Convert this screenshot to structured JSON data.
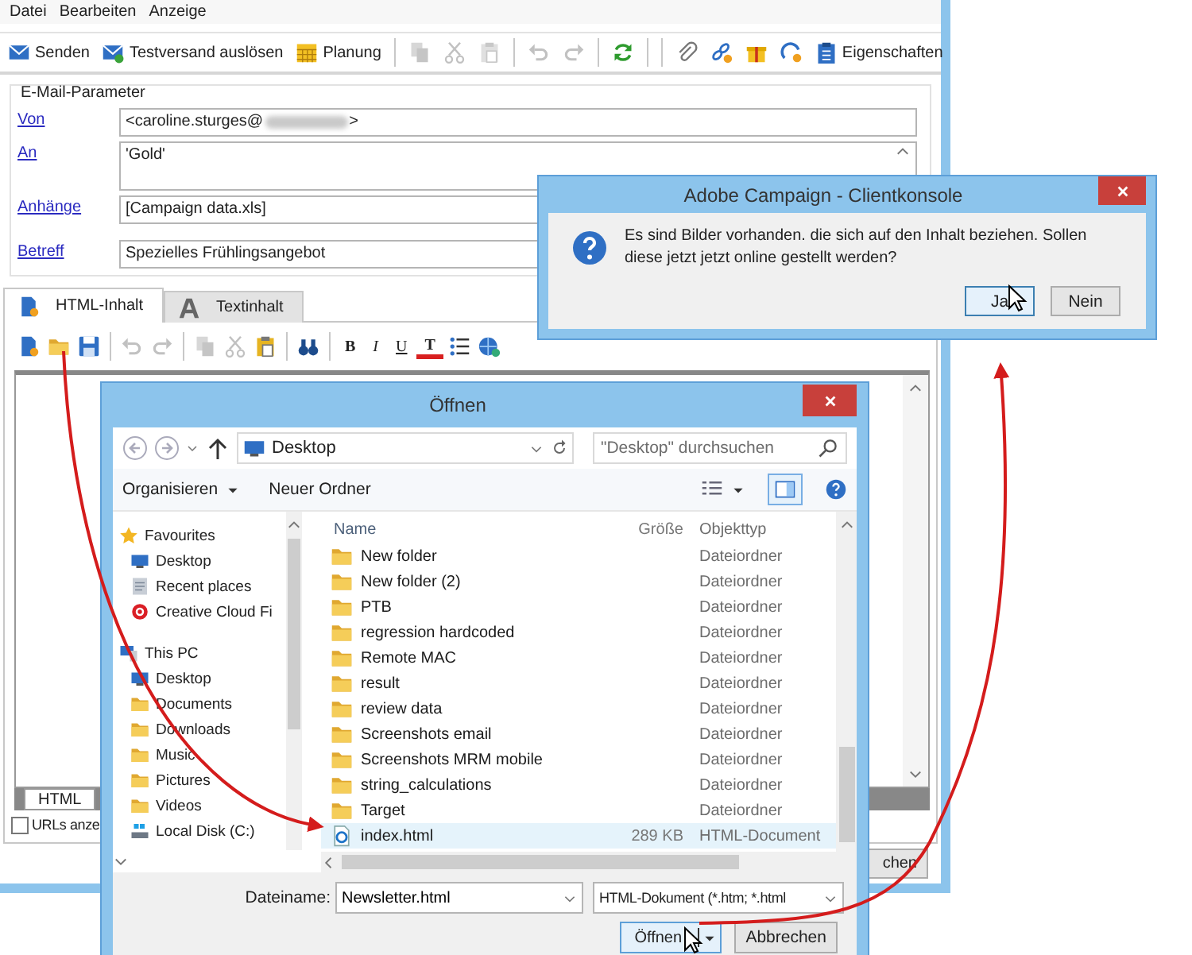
{
  "main_window": {
    "menu": [
      {
        "label": "Datei"
      },
      {
        "label": "Bearbeiten"
      },
      {
        "label": "Anzeige"
      }
    ],
    "toolbar": [
      {
        "kind": "button",
        "label": "Senden",
        "disabled": false
      },
      {
        "kind": "button",
        "label": "Testversand auslösen",
        "disabled": false
      },
      {
        "kind": "button",
        "label": "Planung",
        "disabled": false
      },
      {
        "kind": "separator"
      },
      {
        "kind": "button",
        "disabled": true
      },
      {
        "kind": "button",
        "disabled": true
      },
      {
        "kind": "button",
        "disabled": true
      },
      {
        "kind": "separator"
      },
      {
        "kind": "button",
        "disabled": true
      },
      {
        "kind": "button",
        "disabled": true
      },
      {
        "kind": "separator"
      },
      {
        "kind": "button",
        "disabled": false
      },
      {
        "kind": "separator"
      },
      {
        "kind": "separator"
      },
      {
        "kind": "button",
        "disabled": false
      },
      {
        "kind": "button",
        "disabled": false
      },
      {
        "kind": "button",
        "disabled": false
      },
      {
        "kind": "button",
        "disabled": false
      },
      {
        "kind": "button",
        "label": "Eigenschaften",
        "disabled": false
      }
    ],
    "parameters": {
      "title": "E-Mail-Parameter",
      "fields": [
        {
          "label": "Von",
          "kind": "email",
          "value": "<caroline.sturges@",
          "value_end": ">"
        },
        {
          "label": "An",
          "kind": "multiline",
          "value": "'Gold'"
        },
        {
          "label": "Anhänge",
          "kind": "line",
          "value": "[Campaign data.xls]"
        },
        {
          "label": "Betreff",
          "kind": "line",
          "value": "Spezielles Frühlingsangebot"
        }
      ]
    },
    "tabs": [
      {
        "label": "HTML-Inhalt",
        "selected": true
      },
      {
        "label": "Textinhalt",
        "selected": false
      }
    ],
    "editor_toolbar": [
      {
        "kind": "icon",
        "disabled": false
      },
      {
        "kind": "icon",
        "disabled": false
      },
      {
        "kind": "icon",
        "disabled": false
      },
      {
        "kind": "separator"
      },
      {
        "kind": "icon",
        "disabled": true
      },
      {
        "kind": "icon",
        "disabled": true
      },
      {
        "kind": "separator"
      },
      {
        "kind": "icon",
        "disabled": true
      },
      {
        "kind": "icon",
        "disabled": true
      },
      {
        "kind": "icon",
        "disabled": false
      },
      {
        "kind": "separator"
      },
      {
        "kind": "icon",
        "disabled": false
      },
      {
        "kind": "separator"
      },
      {
        "kind": "bold",
        "label": "B"
      },
      {
        "kind": "italic",
        "label": "I"
      },
      {
        "kind": "underline",
        "label": "U"
      },
      {
        "kind": "clear",
        "label": "T"
      },
      {
        "kind": "icon",
        "disabled": false
      },
      {
        "kind": "icon",
        "disabled": false
      }
    ],
    "source_tabs": [
      {
        "label": "HTML",
        "selected": true
      }
    ],
    "show_urls": {
      "label": "URLs anze",
      "checked": false
    },
    "button": {
      "label": "chen"
    }
  },
  "open_dialog": {
    "title": "Öffnen",
    "address": "Desktop",
    "search_placeholder": "\"Desktop\" durchsuchen",
    "toolbar": [
      {
        "label": "Organisieren",
        "dropdown": true
      },
      {
        "label": "Neuer Ordner",
        "dropdown": false
      }
    ],
    "nav": [
      {
        "label": "Favourites",
        "children": [
          {
            "label": "Desktop"
          },
          {
            "label": "Recent places"
          },
          {
            "label": "Creative Cloud Fi"
          }
        ]
      },
      {
        "label": "This PC",
        "children": [
          {
            "label": "Desktop"
          },
          {
            "label": "Documents"
          },
          {
            "label": "Downloads"
          },
          {
            "label": "Music"
          },
          {
            "label": "Pictures"
          },
          {
            "label": "Videos"
          },
          {
            "label": "Local Disk (C:)"
          }
        ]
      }
    ],
    "columns": [
      "Name",
      "Größe",
      "Objekttyp"
    ],
    "files": [
      {
        "name": "New folder",
        "kind": "folder",
        "type": "Dateiordner",
        "selected": false
      },
      {
        "name": "New folder (2)",
        "kind": "folder",
        "type": "Dateiordner",
        "selected": false
      },
      {
        "name": "PTB",
        "kind": "folder",
        "type": "Dateiordner",
        "selected": false
      },
      {
        "name": "regression hardcoded",
        "kind": "folder",
        "type": "Dateiordner",
        "selected": false
      },
      {
        "name": "Remote MAC",
        "kind": "folder",
        "type": "Dateiordner",
        "selected": false
      },
      {
        "name": "result",
        "kind": "folder",
        "type": "Dateiordner",
        "selected": false
      },
      {
        "name": "review data",
        "kind": "folder",
        "type": "Dateiordner",
        "selected": false
      },
      {
        "name": "Screenshots email",
        "kind": "folder",
        "type": "Dateiordner",
        "selected": false
      },
      {
        "name": "Screenshots MRM mobile",
        "kind": "folder",
        "type": "Dateiordner",
        "selected": false
      },
      {
        "name": "string_calculations",
        "kind": "folder",
        "type": "Dateiordner",
        "selected": false
      },
      {
        "name": "Target",
        "kind": "folder",
        "type": "Dateiordner",
        "selected": false
      },
      {
        "name": "index.html",
        "kind": "html",
        "size": "289 KB",
        "type": "HTML-Document",
        "selected": true
      }
    ],
    "filename_label": "Dateiname:",
    "filename": "Newsletter.html",
    "filter": "HTML-Dokument (*.htm; *.html",
    "buttons": [
      {
        "label": "Öffnen",
        "split": true
      },
      {
        "label": "Abbrechen",
        "split": false
      }
    ]
  },
  "confirm_dialog": {
    "title": "Adobe Campaign - Clientkonsole",
    "message": "Es sind Bilder vorhanden. die sich auf den Inhalt beziehen. Sollen diese jetzt jetzt online gestellt werden?",
    "buttons": [
      {
        "label": "Ja",
        "focused": true
      },
      {
        "label": "Nein",
        "focused": false
      }
    ]
  }
}
